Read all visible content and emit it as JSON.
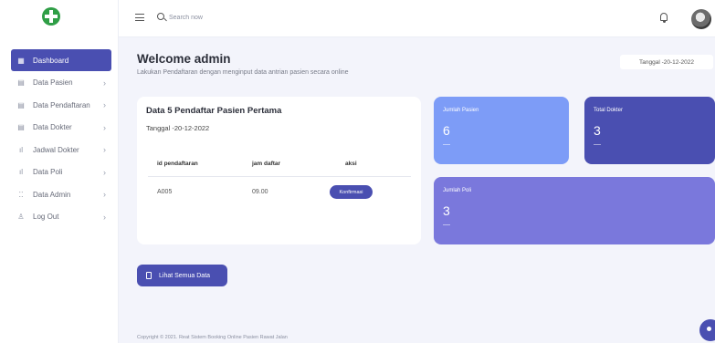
{
  "topbar": {
    "search_placeholder": "Search now"
  },
  "sidebar": {
    "items": [
      {
        "label": "Dashboard",
        "icon": "grid-icon",
        "active": true,
        "chevron": ""
      },
      {
        "label": "Data Pasien",
        "icon": "table-icon",
        "active": false,
        "chevron": "›"
      },
      {
        "label": "Data Pendaftaran",
        "icon": "table-icon",
        "active": false,
        "chevron": "›"
      },
      {
        "label": "Data Dokter",
        "icon": "table-icon",
        "active": false,
        "chevron": "›"
      },
      {
        "label": "Jadwal Dokter",
        "icon": "bar-chart-icon",
        "active": false,
        "chevron": "›"
      },
      {
        "label": "Data Poli",
        "icon": "bar-chart-icon",
        "active": false,
        "chevron": "›"
      },
      {
        "label": "Data Admin",
        "icon": "brackets-icon",
        "active": false,
        "chevron": "›"
      },
      {
        "label": "Log Out",
        "icon": "user-icon",
        "active": false,
        "chevron": "›"
      }
    ]
  },
  "header": {
    "title": "Welcome admin",
    "subtitle": "Lakukan Pendaftaran dengan menginput data antrian pasien secara online",
    "date": "Tanggal -20-12-2022"
  },
  "card": {
    "title": "Data 5 Pendaftar Pasien Pertama",
    "date": "Tanggal -20-12-2022",
    "columns": [
      "id pendaftaran",
      "jam daftar",
      "aksi"
    ],
    "rows": [
      {
        "id": "A005",
        "time": "09.00",
        "action": "Konfirmasi"
      }
    ]
  },
  "stats": {
    "pasien": {
      "label": "Jumlah Pasien",
      "value": "6"
    },
    "dokter": {
      "label": "Total Dokter",
      "value": "3"
    },
    "poli": {
      "label": "Jumlah Poli",
      "value": "3"
    }
  },
  "actions": {
    "view_all": "Lihat Semua Data"
  },
  "footer": {
    "text": "Copyright © 2021. Reat Sistem Booking Online Pasien Rawat Jalan"
  },
  "colors": {
    "accent": "#4a4fb1",
    "stat_pasien": "#7d9cf7",
    "stat_poli": "#7a78dc",
    "logo": "#2f9e46"
  }
}
